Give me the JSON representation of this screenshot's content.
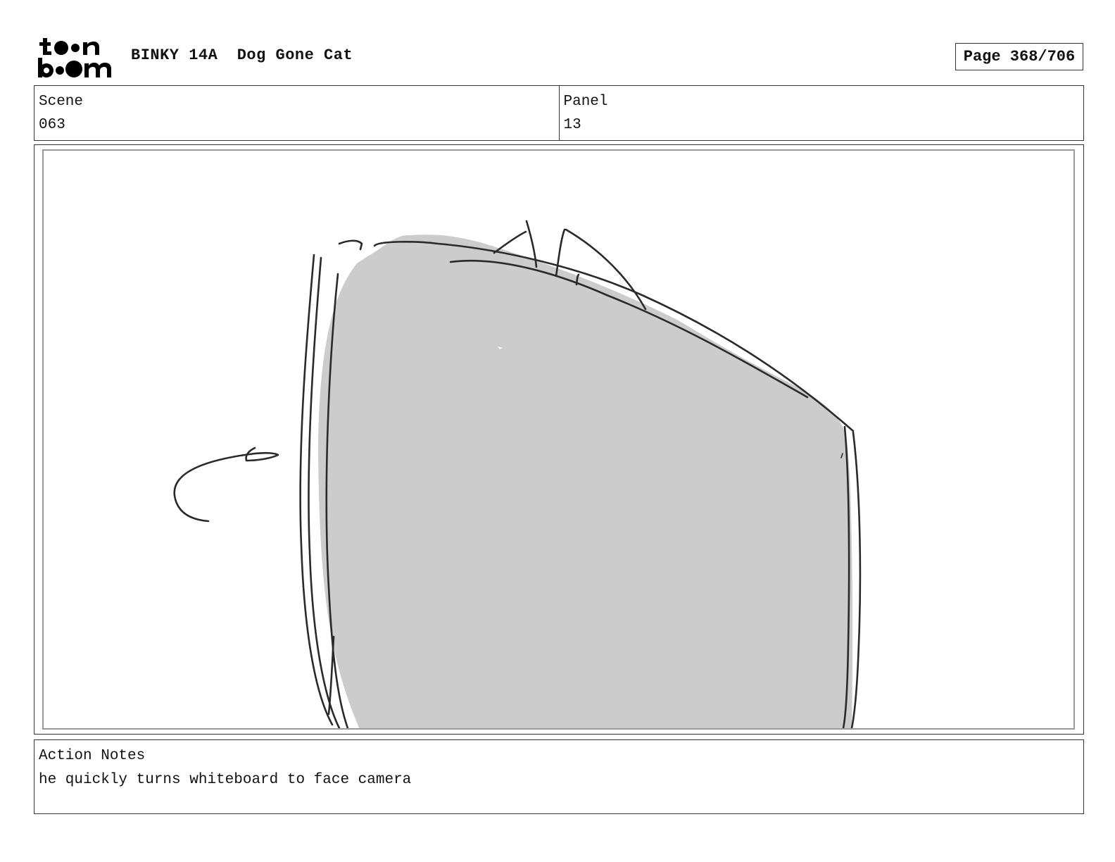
{
  "header": {
    "logo_text": "toon boom",
    "project_title": "BINKY 14A  Dog Gone Cat",
    "page_indicator": "Page 368/706"
  },
  "scene": {
    "label": "Scene",
    "value": "063"
  },
  "panel": {
    "label": "Panel",
    "value": "13"
  },
  "action_notes": {
    "label": "Action Notes",
    "text": "he quickly turns whiteboard to face camera"
  },
  "drawing": {
    "description_icon": "storyboard-sketch",
    "fill_color": "#cccccc",
    "line_color": "#2a2a2a"
  }
}
